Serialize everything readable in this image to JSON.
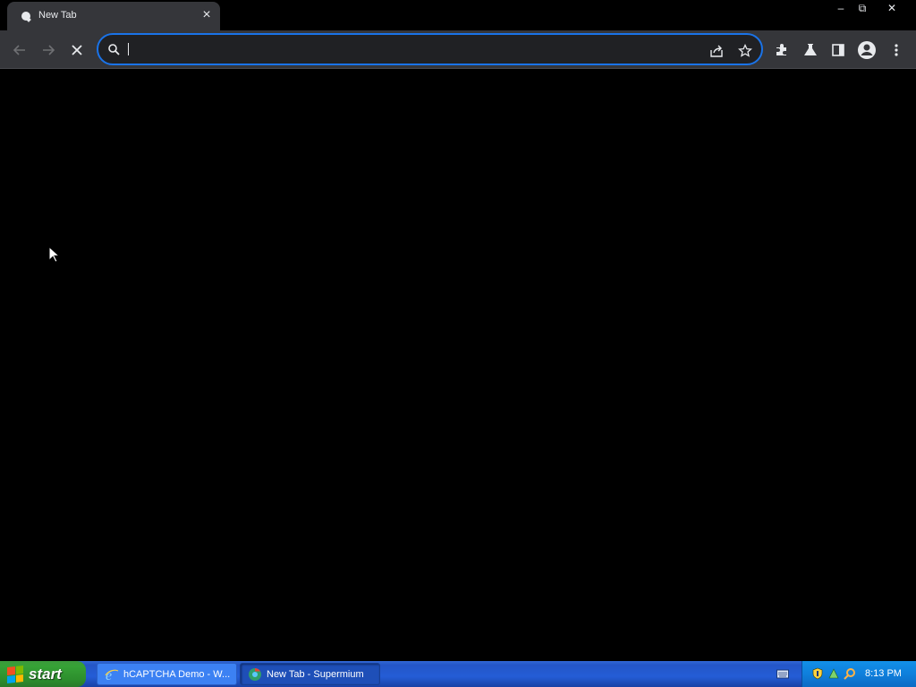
{
  "browser": {
    "tab": {
      "title": "New Tab",
      "close_glyph": "×"
    },
    "window_controls": {
      "minimize": "–",
      "restore": "⧉",
      "close": "✕"
    },
    "omnibox": {
      "value": "",
      "placeholder": ""
    }
  },
  "icons": {
    "back": "back-arrow-icon",
    "forward": "forward-arrow-icon",
    "stop": "stop-loading-icon",
    "search": "search-icon",
    "share": "share-icon",
    "bookmark": "star-icon",
    "extensions": "puzzle-icon",
    "labs": "flask-icon",
    "sidepanel": "side-panel-icon",
    "profile": "profile-avatar-icon",
    "menu": "kebab-menu-icon"
  },
  "taskbar": {
    "start_label": "start",
    "tasks": [
      {
        "label": "hCAPTCHA Demo - W...",
        "icon": "internet-explorer-icon"
      },
      {
        "label": "New Tab - Supermium",
        "icon": "supermium-icon"
      }
    ],
    "clock": "8:13 PM"
  },
  "colors": {
    "accent": "#1a73e8",
    "toolbar": "#35363a",
    "taskbar_blue": "#245dd6",
    "start_green": "#36a236",
    "tray_blue": "#0f7fdc"
  }
}
